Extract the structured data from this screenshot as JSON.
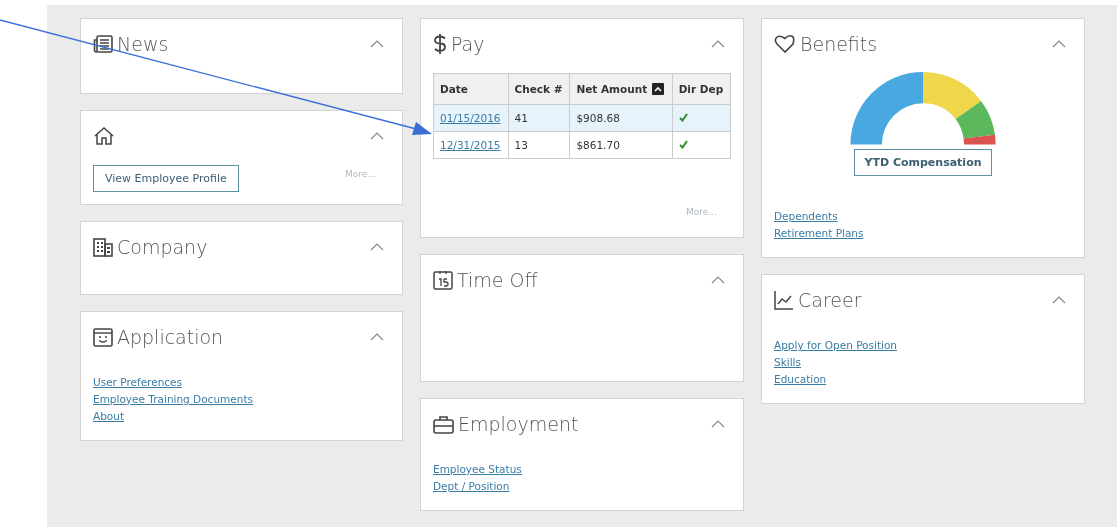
{
  "columns": [
    {
      "cards": [
        {
          "kind": "news",
          "title": "News",
          "body": {
            "kind": "empty"
          }
        },
        {
          "kind": "home",
          "body": {
            "kind": "profile",
            "button": "View Employee Profile",
            "more": "More..."
          }
        },
        {
          "kind": "company",
          "title": "Company",
          "body": {
            "kind": "empty"
          }
        },
        {
          "kind": "app",
          "title": "Application",
          "body": {
            "kind": "links",
            "links": [
              "User Preferences",
              "Employee Training Documents",
              "About"
            ]
          }
        }
      ]
    },
    {
      "cards": [
        {
          "kind": "pay",
          "title": "Pay",
          "body": {
            "kind": "table",
            "columns": [
              {
                "label": "Date",
                "sorted": false
              },
              {
                "label": "Check #",
                "sorted": false
              },
              {
                "label": "Net Amount",
                "sorted": true
              },
              {
                "label": "Dir Dep",
                "sorted": false
              }
            ],
            "rows": [
              {
                "date": "01/15/2016",
                "check": "41",
                "amount": "$908.68",
                "direct_deposit": true,
                "selected": true
              },
              {
                "date": "12/31/2015",
                "check": "13",
                "amount": "$861.70",
                "direct_deposit": true,
                "selected": false
              }
            ],
            "more": "More..."
          }
        },
        {
          "kind": "timeoff",
          "title": "Time Off",
          "body": {
            "kind": "empty"
          }
        },
        {
          "kind": "employment",
          "title": "Employment",
          "body": {
            "kind": "links",
            "links": [
              "Employee Status",
              "Dept / Position"
            ]
          }
        }
      ]
    },
    {
      "cards": [
        {
          "kind": "benefits",
          "title": "Benefits",
          "body": {
            "kind": "gauge",
            "button": "YTD Compensation",
            "links": [
              "Dependents",
              "Retirement Plans"
            ]
          }
        },
        {
          "kind": "career",
          "title": "Career",
          "body": {
            "kind": "links",
            "links": [
              "Apply for Open Position",
              "Skills",
              "Education"
            ]
          }
        }
      ]
    }
  ]
}
